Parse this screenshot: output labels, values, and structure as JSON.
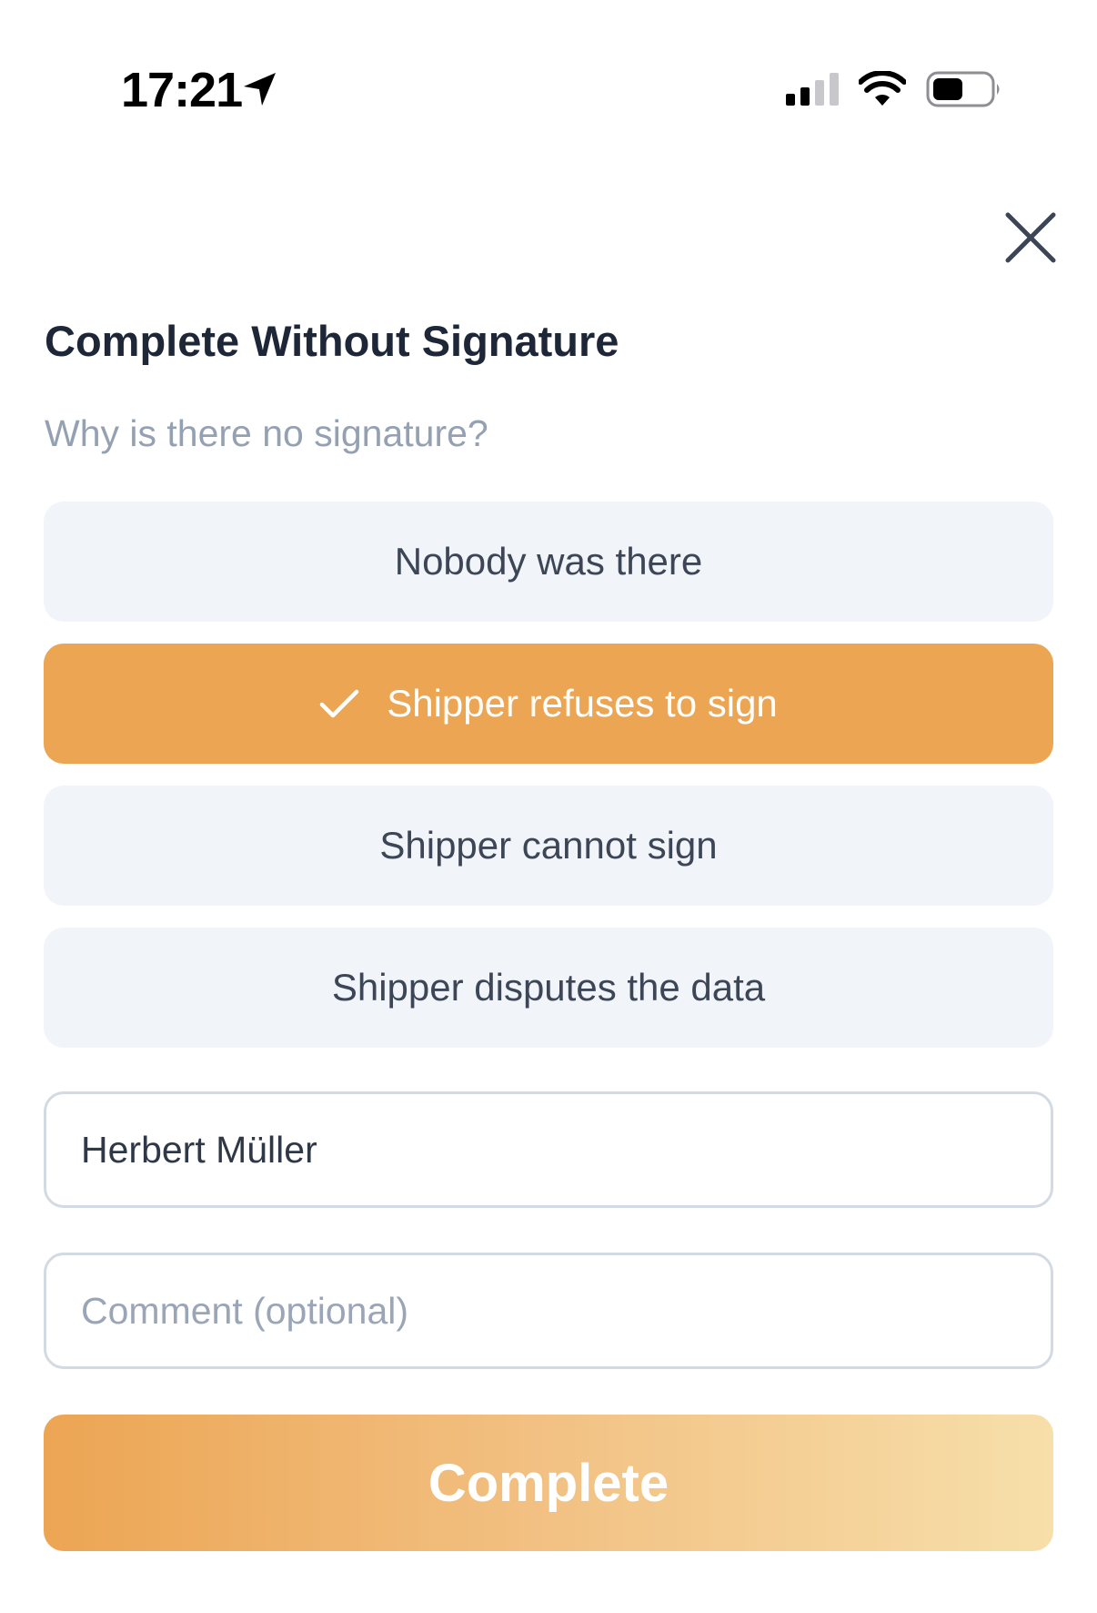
{
  "status_bar": {
    "time": "17:21",
    "icons": [
      "location-arrow-icon",
      "signal-icon",
      "wifi-icon",
      "battery-icon"
    ]
  },
  "header": {
    "close_icon": "close-icon"
  },
  "dialog": {
    "title": "Complete Without Signature",
    "question": "Why is there no signature?",
    "options": [
      {
        "label": "Nobody was there",
        "selected": false
      },
      {
        "label": "Shipper refuses to sign",
        "selected": true,
        "icon": "check-icon"
      },
      {
        "label": "Shipper cannot sign",
        "selected": false
      },
      {
        "label": "Shipper disputes the data",
        "selected": false
      }
    ],
    "name_field": {
      "value": "Herbert Müller",
      "placeholder": ""
    },
    "comment_field": {
      "value": "",
      "placeholder": "Comment (optional)"
    },
    "complete_label": "Complete"
  },
  "colors": {
    "accent": "#eca553",
    "accent_light": "#f7dfaa",
    "option_bg": "#f1f4f9",
    "title": "#1d2737",
    "subtitle": "#94a1b3"
  }
}
